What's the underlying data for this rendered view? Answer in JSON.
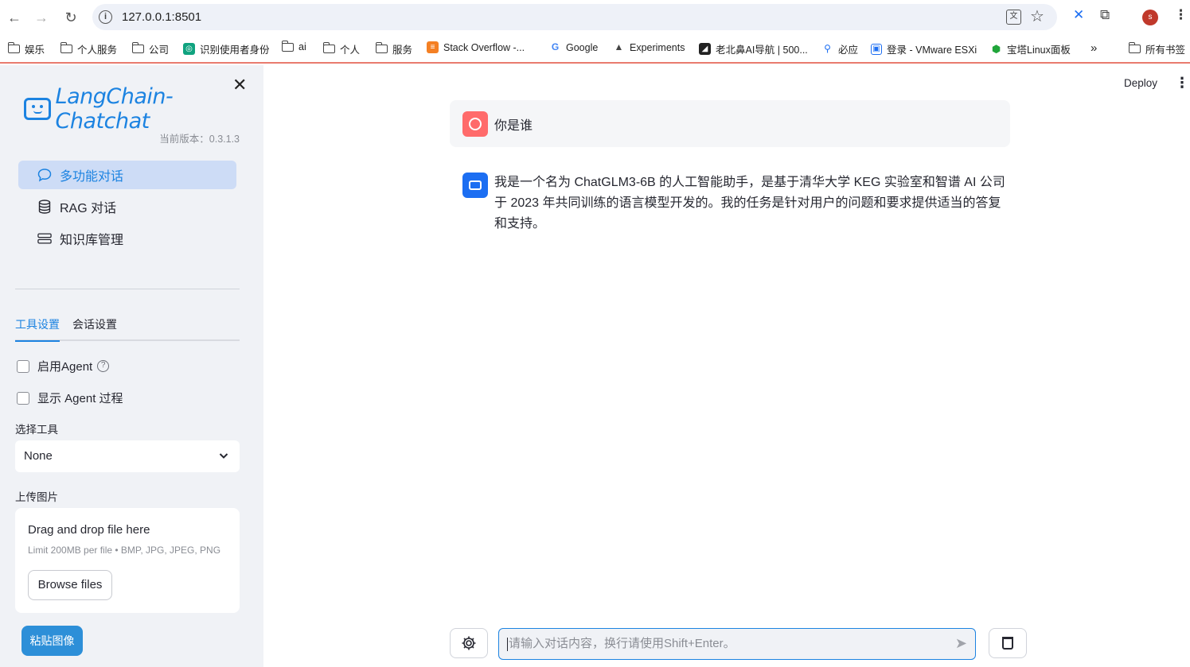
{
  "browser": {
    "url": "127.0.0.1:8501",
    "profile_initial": "s",
    "bookmarks": [
      {
        "label": "娱乐",
        "icon": "folder-icon"
      },
      {
        "label": "个人服务",
        "icon": "folder-icon"
      },
      {
        "label": "公司",
        "icon": "folder-icon"
      },
      {
        "label": "识别使用者身份",
        "icon": "openai-icon"
      },
      {
        "label": "ai",
        "icon": "folder-icon"
      },
      {
        "label": "个人",
        "icon": "folder-icon"
      },
      {
        "label": "服务",
        "icon": "folder-icon"
      },
      {
        "label": "Stack Overflow -...",
        "icon": "stackoverflow-icon"
      },
      {
        "label": "Google",
        "icon": "google-icon"
      },
      {
        "label": "Experiments",
        "icon": "flask-icon"
      },
      {
        "label": "老北鼻AI导航 | 500...",
        "icon": "site-icon"
      },
      {
        "label": "必应",
        "icon": "bing-icon"
      },
      {
        "label": "登录 - VMware ESXi",
        "icon": "vmware-icon"
      },
      {
        "label": "宝塔Linux面板",
        "icon": "bt-icon"
      },
      {
        "label": "所有书签",
        "icon": "folder-icon"
      }
    ]
  },
  "sidebar": {
    "brand": "LangChain-Chatchat",
    "version": "当前版本：0.3.1.3",
    "menu": [
      {
        "label": "多功能对话",
        "icon": "chat-bubble-icon",
        "active": true
      },
      {
        "label": "RAG 对话",
        "icon": "database-icon",
        "active": false
      },
      {
        "label": "知识库管理",
        "icon": "server-icon",
        "active": false
      }
    ],
    "tabs": [
      "工具设置",
      "会话设置"
    ],
    "enable_agent": "启用Agent",
    "show_agent_process": "显示 Agent 过程",
    "select_tool_label": "选择工具",
    "select_tool_value": "None",
    "upload_label": "上传图片",
    "upload_drag": "Drag and drop file here",
    "upload_limit": "Limit 200MB per file • BMP, JPG, JPEG, PNG",
    "browse_button": "Browse files",
    "paste_button": "粘贴图像"
  },
  "header": {
    "deploy": "Deploy"
  },
  "chat": {
    "user_message": "你是谁",
    "assistant_message": "我是一个名为 ChatGLM3-6B 的人工智能助手，是基于清华大学 KEG 实验室和智谱 AI 公司于 2023 年共同训练的语言模型开发的。我的任务是针对用户的问题和要求提供适当的答复和支持。",
    "input_placeholder": "请输入对话内容，换行请使用Shift+Enter。"
  },
  "colors": {
    "accent": "#1c83e1",
    "sidebar_bg": "#f0f2f6",
    "user_avatar": "#ff6b6b",
    "bot_avatar": "#1c6ef2",
    "paste_button": "#2d8fd8"
  }
}
